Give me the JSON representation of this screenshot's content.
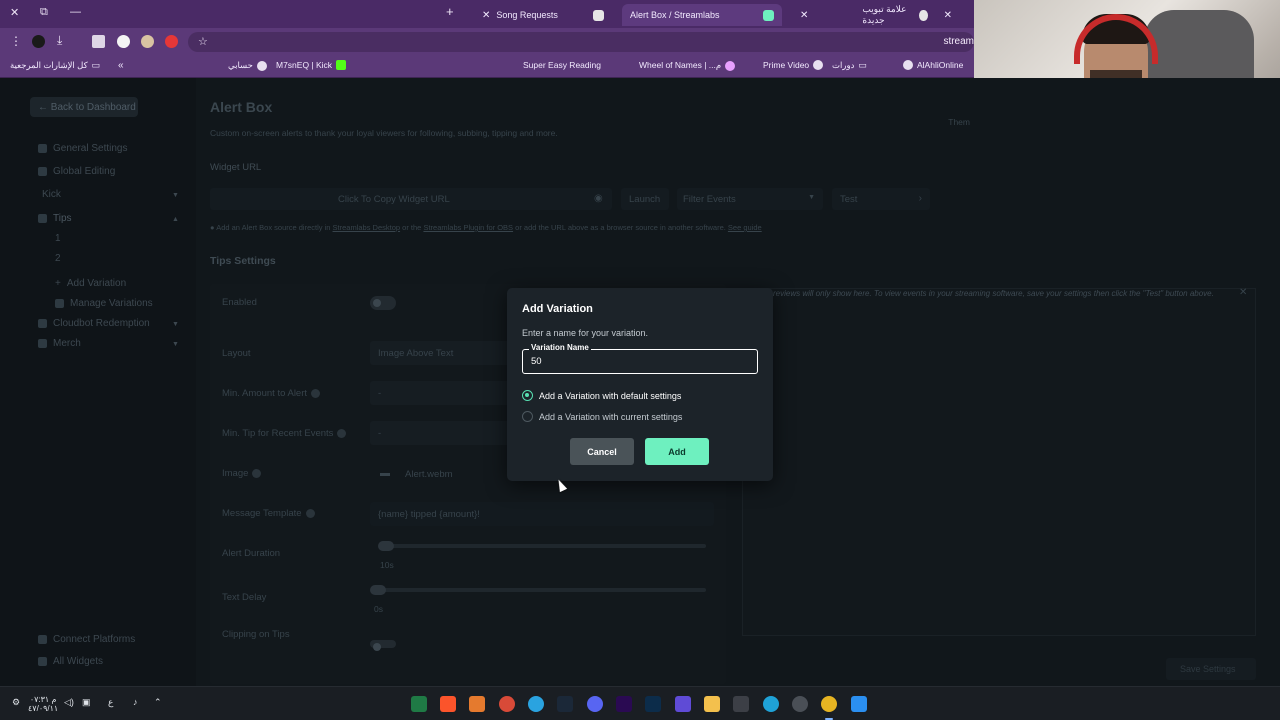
{
  "browser": {
    "tabs": [
      {
        "label": "Song Requests",
        "active": false
      },
      {
        "label": "Alert Box / Streamlabs",
        "active": true
      },
      {
        "label": "علامة تبويب جديدة",
        "active": false
      }
    ],
    "url": "stream",
    "bookmarks": [
      "كل الإشارات المرجعية",
      "حسابي",
      "M7snEQ | Kick",
      "Super Easy Reading",
      "Wheel of Names | ...م",
      "Prime Video",
      "دورات",
      "AlAhliOnline"
    ]
  },
  "sidebar": {
    "back_label": "← Back to Dashboard",
    "items": [
      {
        "label": "General Settings"
      },
      {
        "label": "Global Editing"
      },
      {
        "label": "Kick"
      },
      {
        "label": "Tips"
      },
      {
        "label": "1"
      },
      {
        "label": "2"
      },
      {
        "label": "Add Variation"
      },
      {
        "label": "Manage Variations"
      },
      {
        "label": "Cloudbot Redemption"
      },
      {
        "label": "Merch"
      }
    ],
    "bottom": [
      "Connect Platforms",
      "All Widgets"
    ]
  },
  "main": {
    "title": "Alert Box",
    "subtitle": "Custom on-screen alerts to thank your loyal viewers for following, subbing, tipping and more.",
    "widget_url_label": "Widget URL",
    "copy_label": "Click To Copy Widget URL",
    "launch_label": "Launch",
    "filter_placeholder": "Filter Events",
    "test_label": "Test",
    "theme_label": "Them",
    "hint": {
      "before": "Add an Alert Box source directly in",
      "link1": "Streamlabs Desktop",
      "middle": "or the",
      "link2": "Streamlabs Plugin for OBS",
      "after": "or add the URL above as a browser source in another software.",
      "link3": "See guide"
    },
    "section_title": "Tips Settings",
    "settings": {
      "enabled": "Enabled",
      "layout": "Layout",
      "layout_value": "Image Above Text",
      "min_amount": "Min. Amount to Alert",
      "min_amount_value": "-",
      "min_tip": "Min. Tip for Recent Events",
      "min_tip_value": "-",
      "image": "Image",
      "image_value": "Alert.webm",
      "message_template": "Message Template",
      "message_template_value": "{name} tipped {amount}!",
      "alert_duration": "Alert Duration",
      "alert_duration_value": "10s",
      "text_delay": "Text Delay",
      "text_delay_value": "0s",
      "clipping": "Clipping on Tips"
    },
    "preview_note": "reviews will only show here. To view events in your streaming software, save your settings then click the \"Test\" button above.",
    "save_label": "Save Settings"
  },
  "modal": {
    "title": "Add Variation",
    "description": "Enter a name for your variation.",
    "field_label": "Variation Name",
    "field_value": "50",
    "options": [
      {
        "label": "Add a Variation with default settings",
        "selected": true
      },
      {
        "label": "Add a Variation with current settings",
        "selected": false
      }
    ],
    "cancel_label": "Cancel",
    "add_label": "Add"
  },
  "taskbar": {
    "time": "م ٠٧:٣١",
    "date": "٤٧/٠٩/١١",
    "lang": "ع"
  },
  "colors": {
    "accent": "#6ef0bf",
    "browser_purple": "#5b3978",
    "modal_bg": "#1c2329"
  }
}
